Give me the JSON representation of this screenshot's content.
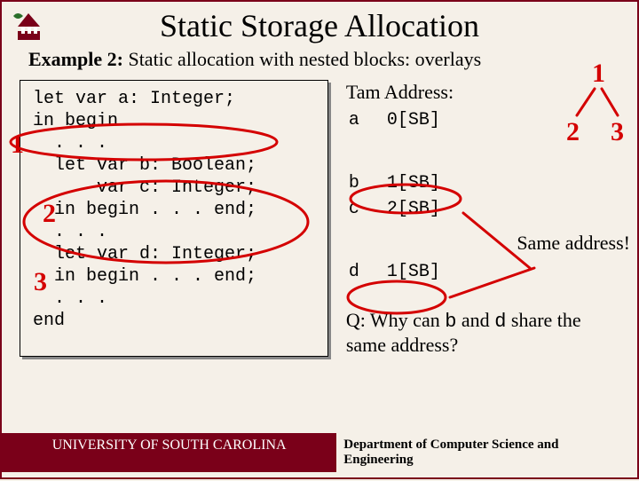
{
  "title": "Static Storage Allocation",
  "subtitle_bold": "Example 2:",
  "subtitle_rest": "Static allocation with nested blocks: overlays",
  "code": "let var a: Integer;\nin begin \n  . . .\n  let var b: Boolean;\n      var c: Integer;\n  in begin . . . end;\n  . . .\n  let var d: Integer;\n  in begin . . . end;\n  . . .\nend",
  "addr_head": "Tam Address:",
  "addr_rows": [
    {
      "name": "a",
      "addr": "0[SB]"
    },
    {
      "name": "b",
      "addr": "1[SB]"
    },
    {
      "name": "c",
      "addr": "2[SB]"
    },
    {
      "name": "d",
      "addr": "1[SB]"
    }
  ],
  "same_label": "Same address!",
  "q_prefix": "Q: Why can ",
  "q_name1": "b",
  "q_mid": " and ",
  "q_name2": "d",
  "q_suffix": " share the same address?",
  "footer_left": "UNIVERSITY OF SOUTH CAROLINA",
  "footer_right": "Department of Computer Science and Engineering",
  "ann": {
    "n1": "1",
    "n2": "2",
    "n3": "3",
    "t1": "1",
    "t2": "2",
    "t3": "3"
  }
}
